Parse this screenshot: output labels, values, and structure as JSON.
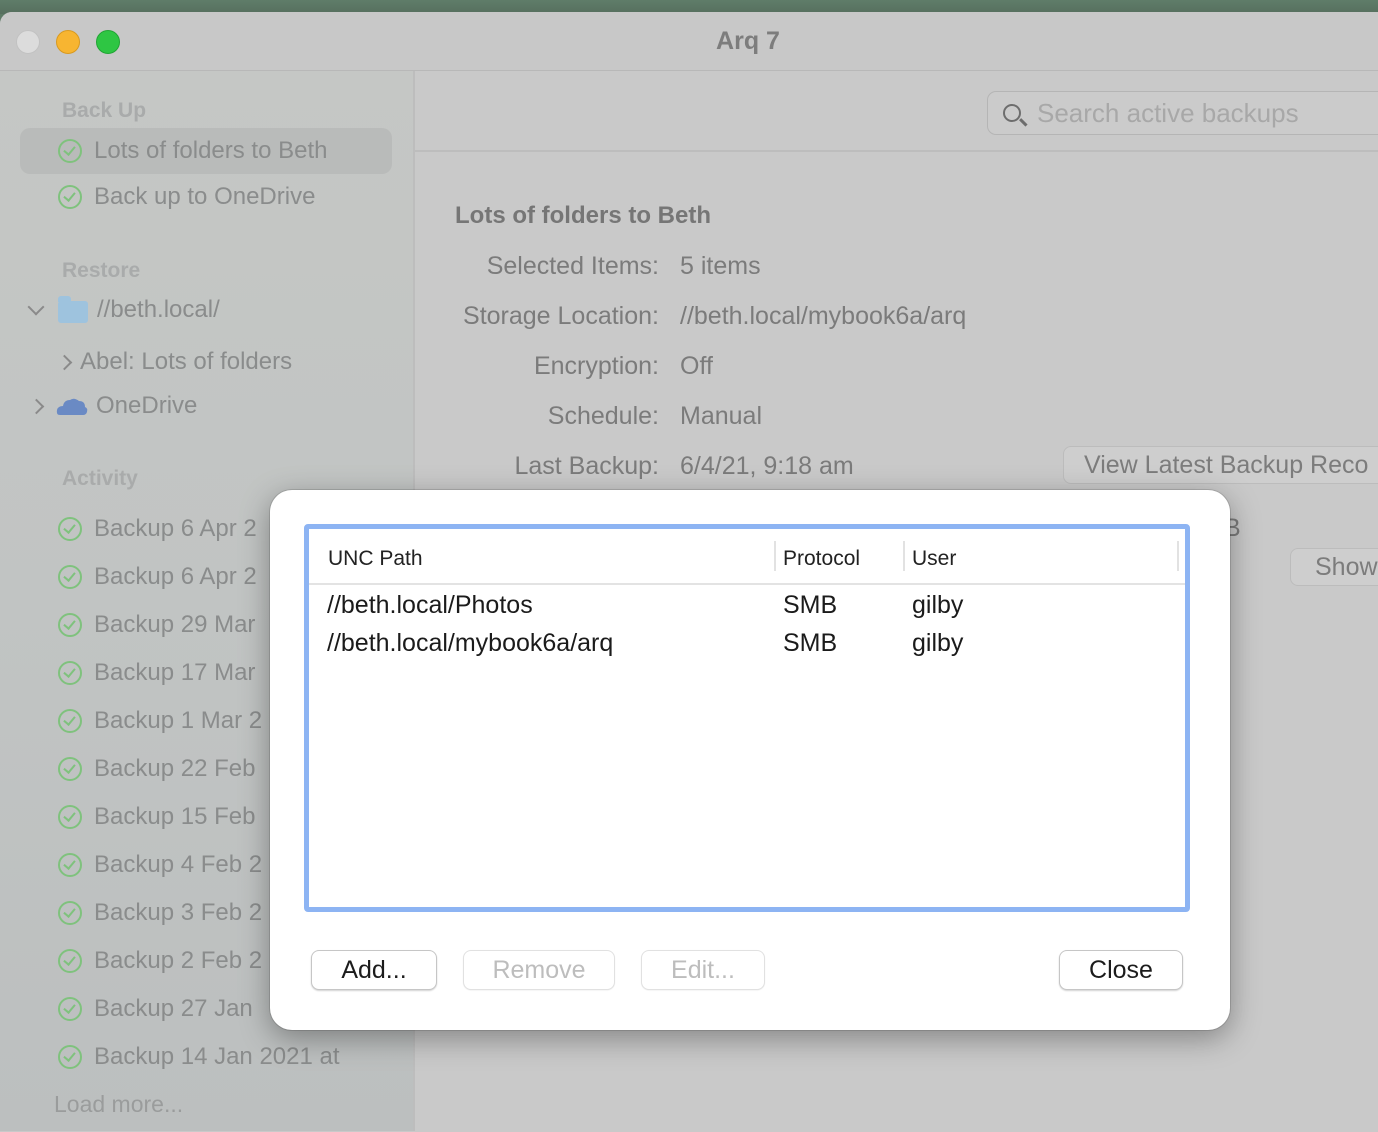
{
  "window": {
    "title": "Arq 7"
  },
  "sidebar": {
    "sections": {
      "backup": "Back Up",
      "restore": "Restore",
      "activity": "Activity"
    },
    "backup_items": [
      {
        "label": "Lots of folders to Beth",
        "status": "success",
        "selected": true
      },
      {
        "label": "Back up to OneDrive",
        "status": "success",
        "selected": false
      }
    ],
    "restore_tree": [
      {
        "label": "//beth.local/",
        "icon": "folder-icon",
        "expanded": true,
        "level": 0
      },
      {
        "label": "Abel: Lots of folders",
        "icon": "",
        "expanded": false,
        "level": 1
      },
      {
        "label": "OneDrive",
        "icon": "cloud-icon",
        "expanded": false,
        "level": 0
      }
    ],
    "activity_items": [
      {
        "label": "Backup 6 Apr 2",
        "status": "success"
      },
      {
        "label": "Backup 6 Apr 2",
        "status": "success"
      },
      {
        "label": "Backup 29 Mar",
        "status": "success"
      },
      {
        "label": "Backup 17 Mar",
        "status": "success"
      },
      {
        "label": "Backup 1 Mar 2",
        "status": "success"
      },
      {
        "label": "Backup 22 Feb",
        "status": "success"
      },
      {
        "label": "Backup 15 Feb",
        "status": "success"
      },
      {
        "label": "Backup 4 Feb 2",
        "status": "success"
      },
      {
        "label": "Backup 3 Feb 2",
        "status": "success"
      },
      {
        "label": "Backup 2 Feb 2",
        "status": "success"
      },
      {
        "label": "Backup 27 Jan",
        "status": "success"
      },
      {
        "label": "Backup 14 Jan 2021 at",
        "status": "success"
      }
    ],
    "load_more": "Load more..."
  },
  "toolbar": {
    "search_placeholder": "Search active backups"
  },
  "detail": {
    "title": "Lots of folders to Beth",
    "rows": [
      {
        "label": "Selected Items:",
        "value": "5 items"
      },
      {
        "label": "Storage Location:",
        "value": "//beth.local/mybook6a/arq"
      },
      {
        "label": "Encryption:",
        "value": "Off"
      },
      {
        "label": "Schedule:",
        "value": "Manual"
      },
      {
        "label": "Last Backup:",
        "value": "6/4/21, 9:18 am"
      }
    ],
    "view_latest_button": "View Latest Backup Reco",
    "partial_value": "B",
    "show_button": "Show"
  },
  "dialog": {
    "columns": [
      "UNC Path",
      "Protocol",
      "User"
    ],
    "rows": [
      {
        "path": "//beth.local/Photos",
        "protocol": "SMB",
        "user": "gilby"
      },
      {
        "path": "//beth.local/mybook6a/arq",
        "protocol": "SMB",
        "user": "gilby"
      }
    ],
    "buttons": {
      "add": "Add...",
      "remove": "Remove",
      "edit": "Edit...",
      "close": "Close"
    },
    "focus_color": "#8db4f3"
  },
  "colors": {
    "success_green": "#7fc27d",
    "traffic_close": "#dcdcdc",
    "traffic_minimize": "#f7b531",
    "traffic_maximize": "#2ec643"
  }
}
